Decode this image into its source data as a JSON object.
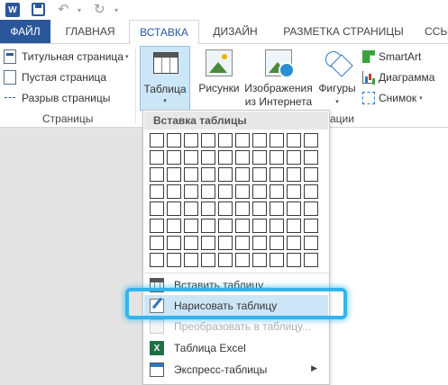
{
  "app": {
    "logo_letter": "W"
  },
  "quick_access": {
    "undo_glyph": "↶",
    "redo_glyph": "↻",
    "dropdown_glyph": "▾"
  },
  "tabs": [
    {
      "label": "ФАЙЛ"
    },
    {
      "label": "ГЛАВНАЯ"
    },
    {
      "label": "ВСТАВКА"
    },
    {
      "label": "ДИЗАЙН"
    },
    {
      "label": "РАЗМЕТКА СТРАНИЦЫ"
    },
    {
      "label": "ССЫ"
    }
  ],
  "ribbon": {
    "pages_group": {
      "label": "Страницы",
      "items": [
        {
          "label": "Титульная страница",
          "icon": "cover-page-icon",
          "has_dropdown": true
        },
        {
          "label": "Пустая страница",
          "icon": "blank-page-icon"
        },
        {
          "label": "Разрыв страницы",
          "icon": "page-break-icon"
        }
      ]
    },
    "table_button": {
      "label": "Таблица",
      "arrow": "▾"
    },
    "illustrations_group": {
      "label": "ации",
      "buttons": [
        {
          "label": "Рисунки"
        },
        {
          "label_line1": "Изображения",
          "label_line2": "из Интернета"
        },
        {
          "label": "Фигуры",
          "arrow": "▾"
        }
      ],
      "small_items": [
        {
          "label": "SmartArt"
        },
        {
          "label": "Диаграмма"
        },
        {
          "label": "Снимок",
          "arrow": "▾"
        }
      ]
    }
  },
  "table_dropdown": {
    "header": "Вставка таблицы",
    "grid": {
      "columns": 10,
      "rows": 8
    },
    "menu_items": [
      {
        "label": "Вставить таблицу...",
        "enabled": true
      },
      {
        "label": "Нарисовать таблицу",
        "enabled": true,
        "highlighted": true
      },
      {
        "label": "Преобразовать в таблицу...",
        "enabled": false
      },
      {
        "label": "Таблица Excel",
        "enabled": true
      },
      {
        "label": "Экспресс-таблицы",
        "enabled": true,
        "submenu_arrow": "▶"
      }
    ]
  },
  "colors": {
    "accent": "#2b579a",
    "highlight_ring": "#33b4ec",
    "hover_bg": "#cde6f7"
  }
}
